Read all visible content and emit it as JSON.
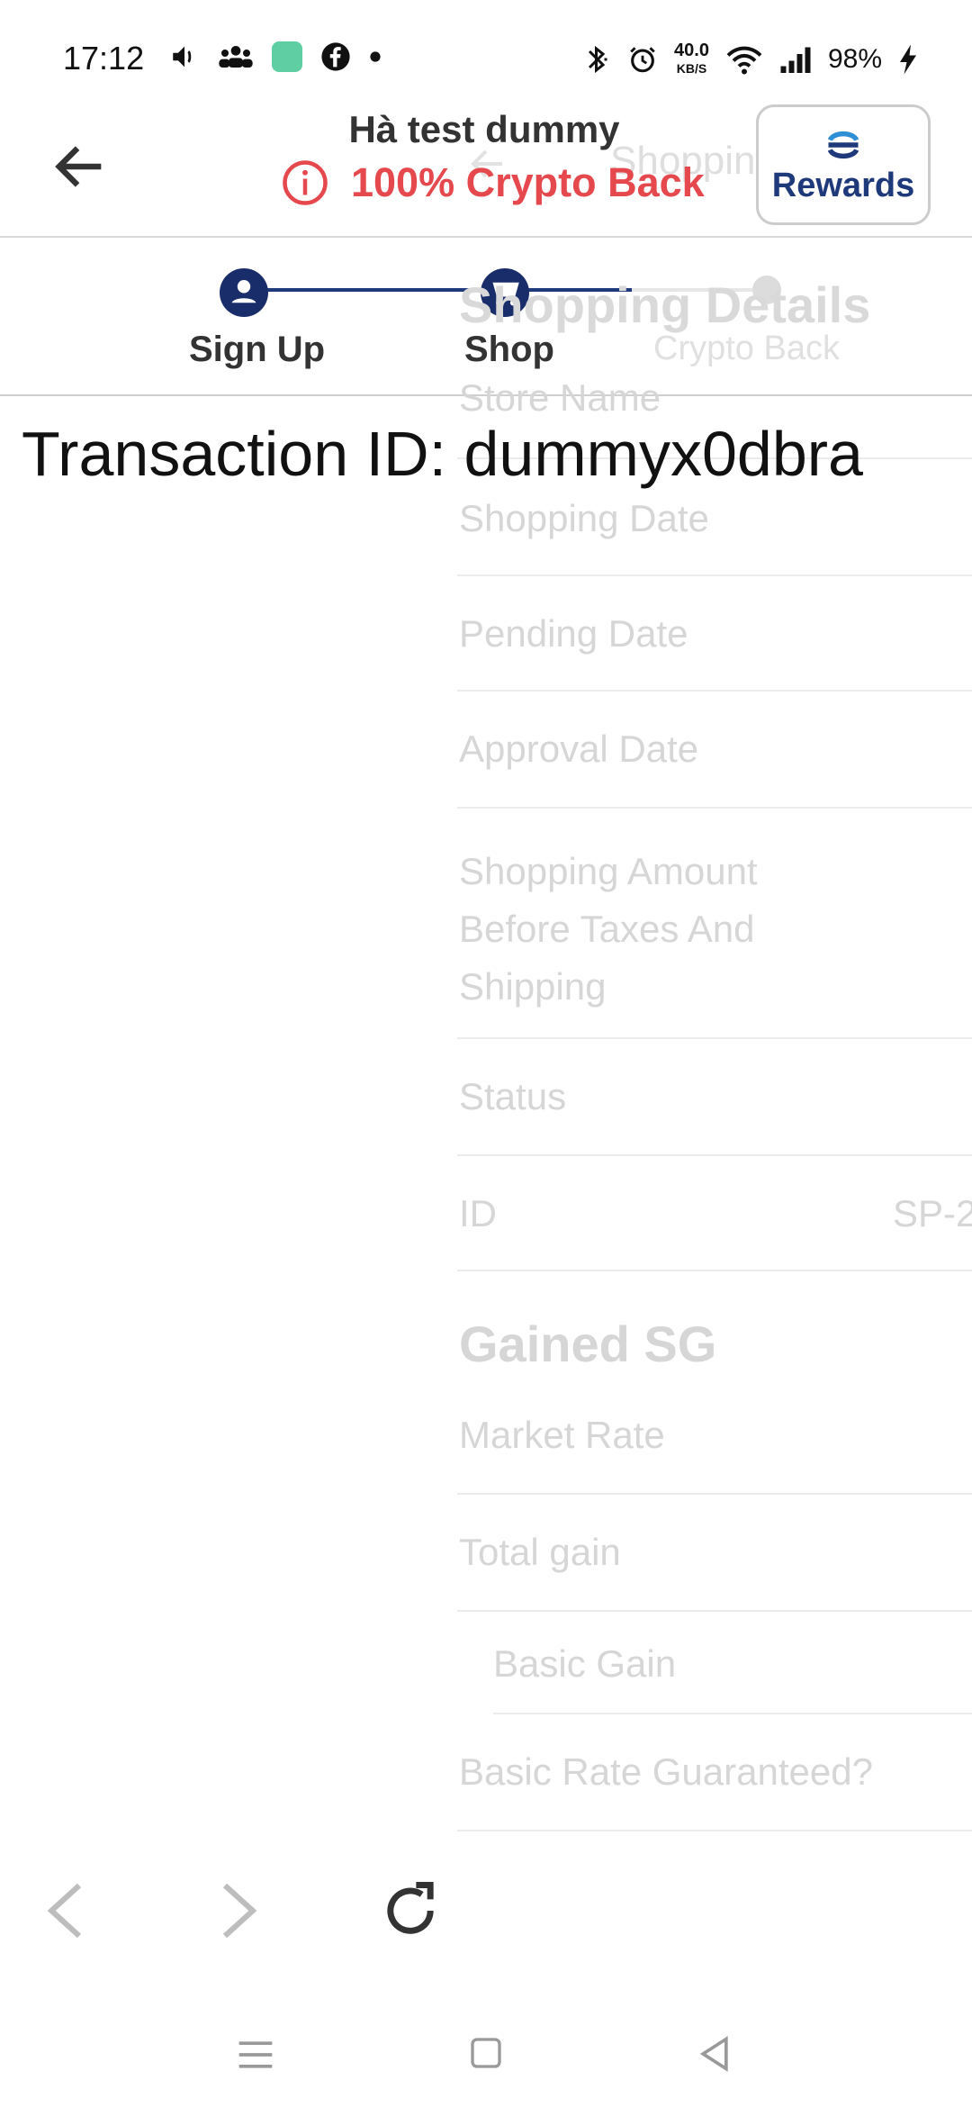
{
  "status_bar": {
    "time": "17:12",
    "net_speed": "40.0",
    "net_speed_unit": "KB/S",
    "battery": "98%"
  },
  "header": {
    "title": "Hà test dummy",
    "subtitle": "100% Crypto Back",
    "rewards_label": "Rewards"
  },
  "stepper": {
    "steps": [
      {
        "label": "Sign Up"
      },
      {
        "label": "Shop"
      },
      {
        "label": "Crypto Back"
      }
    ]
  },
  "transaction": {
    "text": "Transaction ID: dummyx0dbra"
  },
  "ghost_screen": {
    "title": "Shopping Details",
    "section_title": "Shopping Details",
    "rows": [
      {
        "label": "Store Name"
      },
      {
        "label": "Shopping Date"
      },
      {
        "label": "Pending Date"
      },
      {
        "label": "Approval Date"
      },
      {
        "label": "Shopping Amount Before Taxes And Shipping"
      },
      {
        "label": "Status"
      },
      {
        "label": "ID",
        "value": "SP-2"
      }
    ],
    "gained_title": "Gained SG",
    "gained_rows": [
      {
        "label": "Market Rate"
      },
      {
        "label": "Total gain"
      },
      {
        "label": "Basic Gain"
      },
      {
        "label": "Basic Rate Guaranteed?"
      }
    ]
  },
  "colors": {
    "accent": "#1f3a7a",
    "alert": "#e5484d",
    "ghost_text": "#d6d6d6"
  },
  "icons": [
    "volume-icon",
    "group-icon",
    "app-icon",
    "facebook-icon",
    "bluetooth-icon",
    "alarm-icon",
    "wifi-icon",
    "signal-icon",
    "charging-icon",
    "back-arrow-icon",
    "info-icon",
    "sg-logo-icon",
    "user-icon",
    "cart-icon",
    "chevron-left-icon",
    "chevron-right-icon",
    "reload-icon",
    "menu-icon",
    "home-icon",
    "back-triangle-icon"
  ]
}
